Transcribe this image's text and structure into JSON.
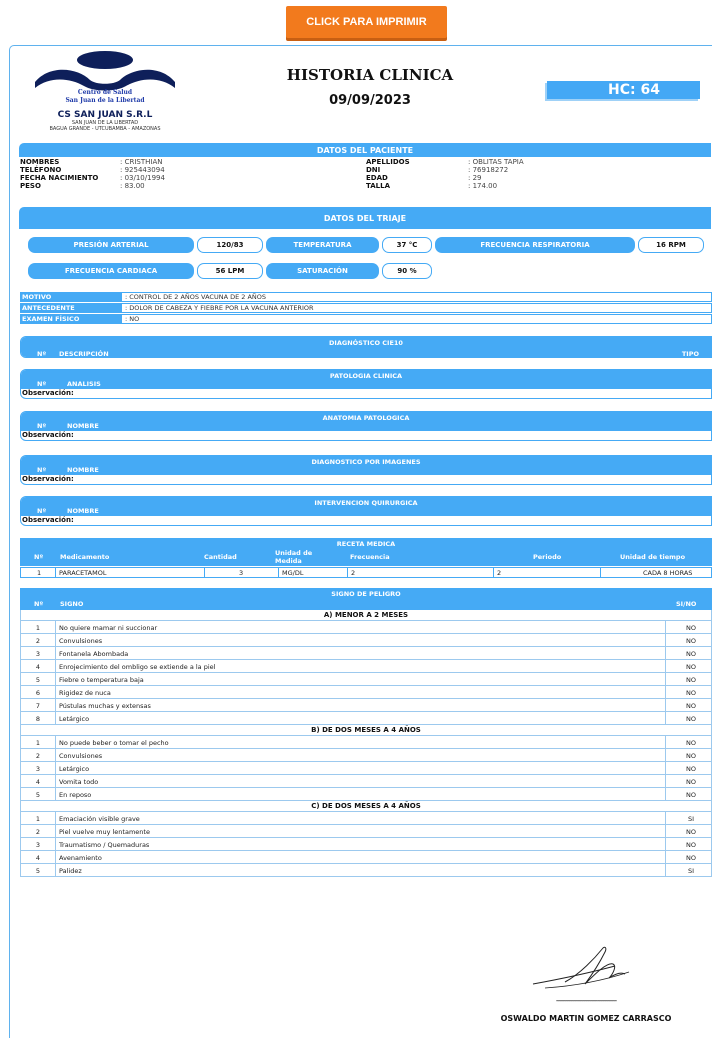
{
  "print_button": "CLICK PARA IMPRIMIR",
  "header": {
    "org_line1": "Centro de Salud",
    "org_line2": "San Juan de la Libertad",
    "clinic_name": "CS SAN JUAN S.R.L",
    "addr1": "SAN JUAN DE LA LIBERTAD",
    "addr2": "BAGUA GRANDE - UTCUBAMBA - AMAZONAS",
    "title": "HISTORIA CLINICA",
    "date": "09/09/2023",
    "hc": "HC: 64"
  },
  "patient": {
    "title": "DATOS DEL PACIENTE",
    "left": [
      {
        "label": "NOMBRES",
        "value": ": CRISTHIAN"
      },
      {
        "label": "TELÉFONO",
        "value": ": 925443094"
      },
      {
        "label": "FECHA NACIMIENTO",
        "value": ": 03/10/1994"
      },
      {
        "label": "PESO",
        "value": ": 83.00"
      }
    ],
    "right": [
      {
        "label": "APELLIDOS",
        "value": ": OBLITAS TAPIA"
      },
      {
        "label": "DNI",
        "value": ": 76918272"
      },
      {
        "label": "EDAD",
        "value": ": 29"
      },
      {
        "label": "TALLA",
        "value": ": 174.00"
      }
    ]
  },
  "triage": {
    "title": "DATOS DEL TRIAJE",
    "pa_label": "PRESIÓN ARTERIAL",
    "pa_value": "120/83",
    "temp_label": "TEMPERATURA",
    "temp_value": "37 °C",
    "fr_label": "FRECUENCIA RESPIRATORIA",
    "fr_value": "16 RPM",
    "fc_label": "FRECUENCIA CARDIACA",
    "fc_value": "56 LPM",
    "sat_label": "SATURACIÓN",
    "sat_value": "90 %"
  },
  "motivo": [
    {
      "label": "MOTIVO",
      "value": ": CONTROL DE 2 AÑOS VACUNA DE 2 AÑOS"
    },
    {
      "label": "ANTECEDENTE",
      "value": ": DOLOR DE CABEZA Y FIEBRE POR LA VACUNA ANTERIOR"
    },
    {
      "label": "EXAMEN FÍSICO",
      "value": ": NO"
    }
  ],
  "cie10": {
    "title": "DIAGNÓSTICO CIE10",
    "col1": "Nº",
    "col2": "DESCRIPCIÓN",
    "col3": "TIPO"
  },
  "patologia": {
    "title": "PATOLOGIA CLINICA",
    "col1": "Nº",
    "col2": "ANALISIS",
    "obs": "Observación:"
  },
  "anatomia": {
    "title": "ANATOMIA PATOLOGICA",
    "col1": "Nº",
    "col2": "NOMBRE",
    "obs": "Observación:"
  },
  "imagenes": {
    "title": "DIAGNOSTICO POR IMAGENES",
    "col1": "Nº",
    "col2": "NOMBRE",
    "obs": "Observación:"
  },
  "quirurgica": {
    "title": "INTERVENCION QUIRURGICA",
    "col1": "Nº",
    "col2": "NOMBRE",
    "obs": "Observación:"
  },
  "receta": {
    "title": "RECETA MEDICA",
    "cols": [
      "Nº",
      "Medicamento",
      "Cantidad",
      "Unidad de",
      "Medida",
      "Frecuencia",
      "Periodo",
      "Unidad de tiempo"
    ],
    "row": {
      "n": "1",
      "med": "PARACETAMOL",
      "cant": "3",
      "unidad": "MG/DL",
      "frec": "2",
      "periodo": "2",
      "tiempo": "CADA 8 HORAS"
    }
  },
  "signos": {
    "title": "SIGNO DE PELIGRO",
    "col1": "Nº",
    "col2": "SIGNO",
    "col3": "SI/NO",
    "groups": [
      {
        "title": "A) MENOR A 2 MESES",
        "rows": [
          {
            "n": "1",
            "d": "No quiere mamar ni succionar",
            "r": "NO"
          },
          {
            "n": "2",
            "d": "Convulsiones",
            "r": "NO"
          },
          {
            "n": "3",
            "d": "Fontanela Abombada",
            "r": "NO"
          },
          {
            "n": "4",
            "d": "Enrojecimiento del ombligo se extiende a la piel",
            "r": "NO"
          },
          {
            "n": "5",
            "d": "Fiebre o temperatura baja",
            "r": "NO"
          },
          {
            "n": "6",
            "d": "Rigidez de nuca",
            "r": "NO"
          },
          {
            "n": "7",
            "d": "Pústulas muchas y extensas",
            "r": "NO"
          },
          {
            "n": "8",
            "d": "Letárgico",
            "r": "NO"
          }
        ]
      },
      {
        "title": "B) DE DOS MESES A 4 AÑOS",
        "rows": [
          {
            "n": "1",
            "d": "No puede beber o tomar el pecho",
            "r": "NO"
          },
          {
            "n": "2",
            "d": "Convulsiones",
            "r": "NO"
          },
          {
            "n": "3",
            "d": "Letárgico",
            "r": "NO"
          },
          {
            "n": "4",
            "d": "Vomita todo",
            "r": "NO"
          },
          {
            "n": "5",
            "d": "En reposo",
            "r": "NO"
          }
        ]
      },
      {
        "title": "C) DE DOS MESES A 4 AÑOS",
        "rows": [
          {
            "n": "1",
            "d": "Emaciación visible grave",
            "r": "SI"
          },
          {
            "n": "2",
            "d": "Piel vuelve muy lentamente",
            "r": "NO"
          },
          {
            "n": "3",
            "d": "Traumatismo / Quemaduras",
            "r": "NO"
          },
          {
            "n": "4",
            "d": "Avenamiento",
            "r": "NO"
          },
          {
            "n": "5",
            "d": "Palidez",
            "r": "SI"
          }
        ]
      }
    ]
  },
  "signature": {
    "dashes": "--------------------------------",
    "name": "OSWALDO MARTIN GOMEZ CARRASCO"
  }
}
